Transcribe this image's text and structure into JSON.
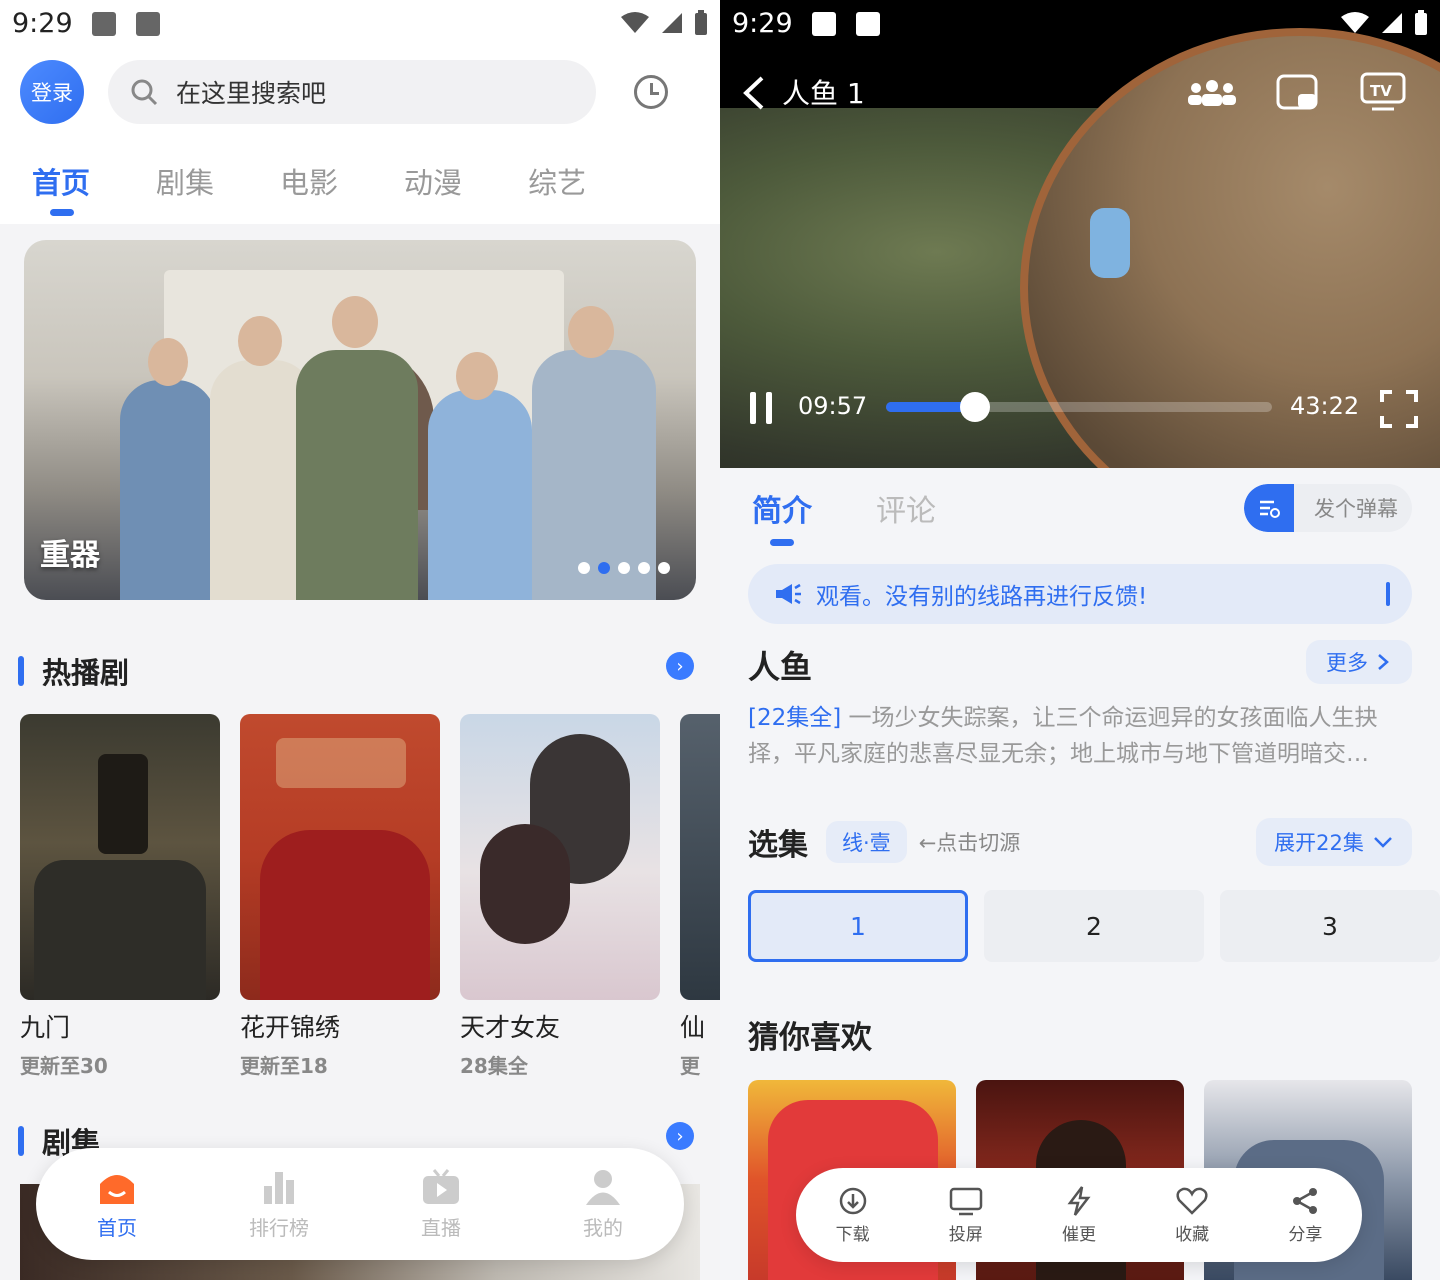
{
  "left": {
    "status": {
      "time": "9:29"
    },
    "header": {
      "login": "登录",
      "search_placeholder": "在这里搜索吧"
    },
    "tabs": [
      {
        "label": "首页",
        "active": true
      },
      {
        "label": "剧集",
        "active": false
      },
      {
        "label": "电影",
        "active": false
      },
      {
        "label": "动漫",
        "active": false
      },
      {
        "label": "综艺",
        "active": false
      }
    ],
    "banner": {
      "title": "重器",
      "pages": 5,
      "current_page": 2
    },
    "hot": {
      "title": "热播剧",
      "items": [
        {
          "name": "九门",
          "sub": "更新至30"
        },
        {
          "name": "花开锦绣",
          "sub": "更新至18"
        },
        {
          "name": "天才女友",
          "sub": "28集全"
        },
        {
          "name": "仙",
          "sub": "更"
        }
      ]
    },
    "series": {
      "title": "剧集"
    },
    "bottom_nav": [
      {
        "label": "首页",
        "icon": "home-icon",
        "active": true
      },
      {
        "label": "排行榜",
        "icon": "bar-chart-icon",
        "active": false
      },
      {
        "label": "直播",
        "icon": "tv-play-icon",
        "active": false
      },
      {
        "label": "我的",
        "icon": "user-icon",
        "active": false
      }
    ]
  },
  "right": {
    "status": {
      "time": "9:29"
    },
    "player": {
      "title": "人鱼 1",
      "current_time": "09:57",
      "total_time": "43:22",
      "progress": 0.23
    },
    "tabs": [
      {
        "label": "简介",
        "active": true
      },
      {
        "label": "评论",
        "active": false
      }
    ],
    "danmaku": "发个弹幕",
    "notice": "观看。没有别的线路再进行反馈!",
    "show": {
      "title": "人鱼",
      "more": "更多",
      "tag": "[22集全]",
      "description": "一场少女失踪案，让三个命运迥异的女孩面临人生抉择，平凡家庭的悲喜尽显无余；地上城市与地下管道明暗交…"
    },
    "episodes": {
      "title": "选集",
      "line": "线·壹",
      "hint": "←点击切源",
      "expand": "展开22集",
      "items": [
        "1",
        "2",
        "3"
      ],
      "selected": "1"
    },
    "guess": {
      "title": "猜你喜欢"
    },
    "actions": [
      {
        "label": "下载",
        "icon": "download-icon"
      },
      {
        "label": "投屏",
        "icon": "cast-screen-icon"
      },
      {
        "label": "催更",
        "icon": "lightning-icon"
      },
      {
        "label": "收藏",
        "icon": "heart-icon"
      },
      {
        "label": "分享",
        "icon": "share-icon"
      }
    ],
    "accent": "#2f6ef0"
  }
}
